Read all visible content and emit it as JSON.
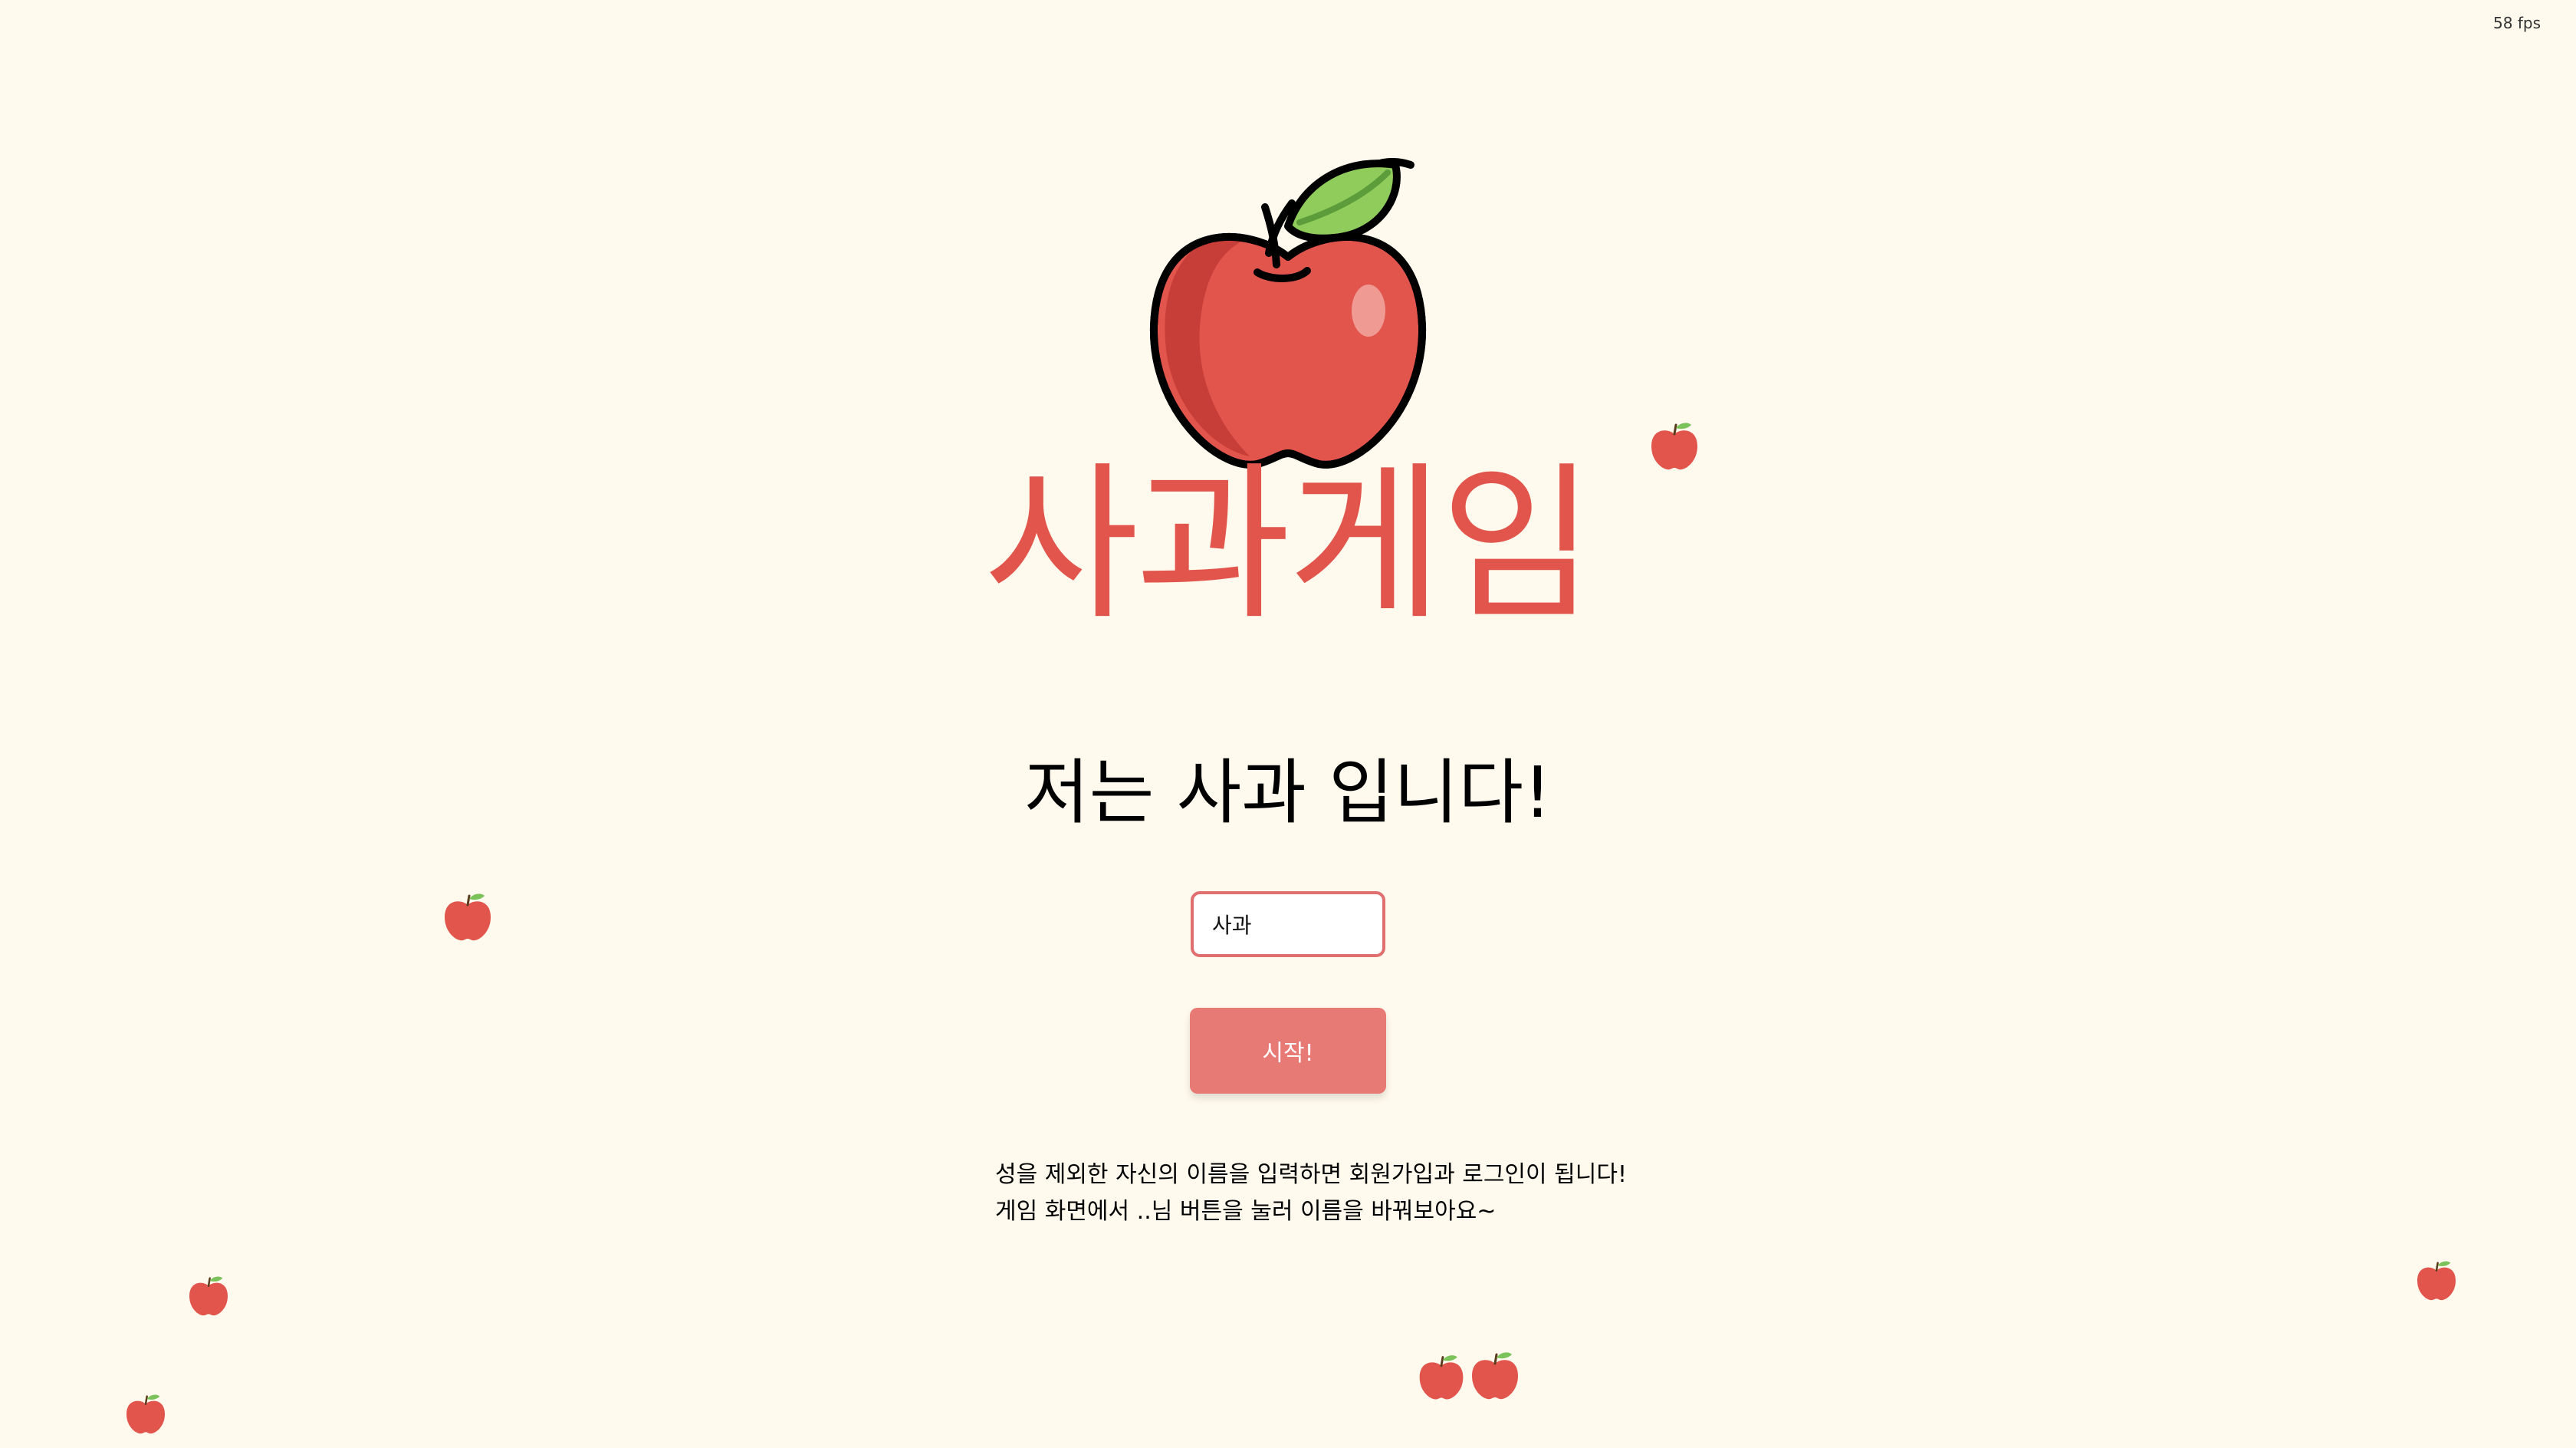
{
  "overlay": {
    "fps_label": "58 fps"
  },
  "game": {
    "title": "사과게임",
    "subtitle": "저는 사과 입니다!"
  },
  "login": {
    "name_value": "사과",
    "start_label": "시작!"
  },
  "help": {
    "line1": "성을 제외한 자신의 이름을 입력하면 회원가입과 로그인이 됩니다!",
    "line2": "게임 화면에서 ..님 버튼을 눌러 이름을 바꿔보아요~"
  },
  "icons": {
    "hero": "apple-icon",
    "falling": "apple-icon"
  },
  "colors": {
    "background": "#fffaed",
    "title": "#e2554d",
    "button": "#e87a76",
    "input_border": "#e07070"
  }
}
